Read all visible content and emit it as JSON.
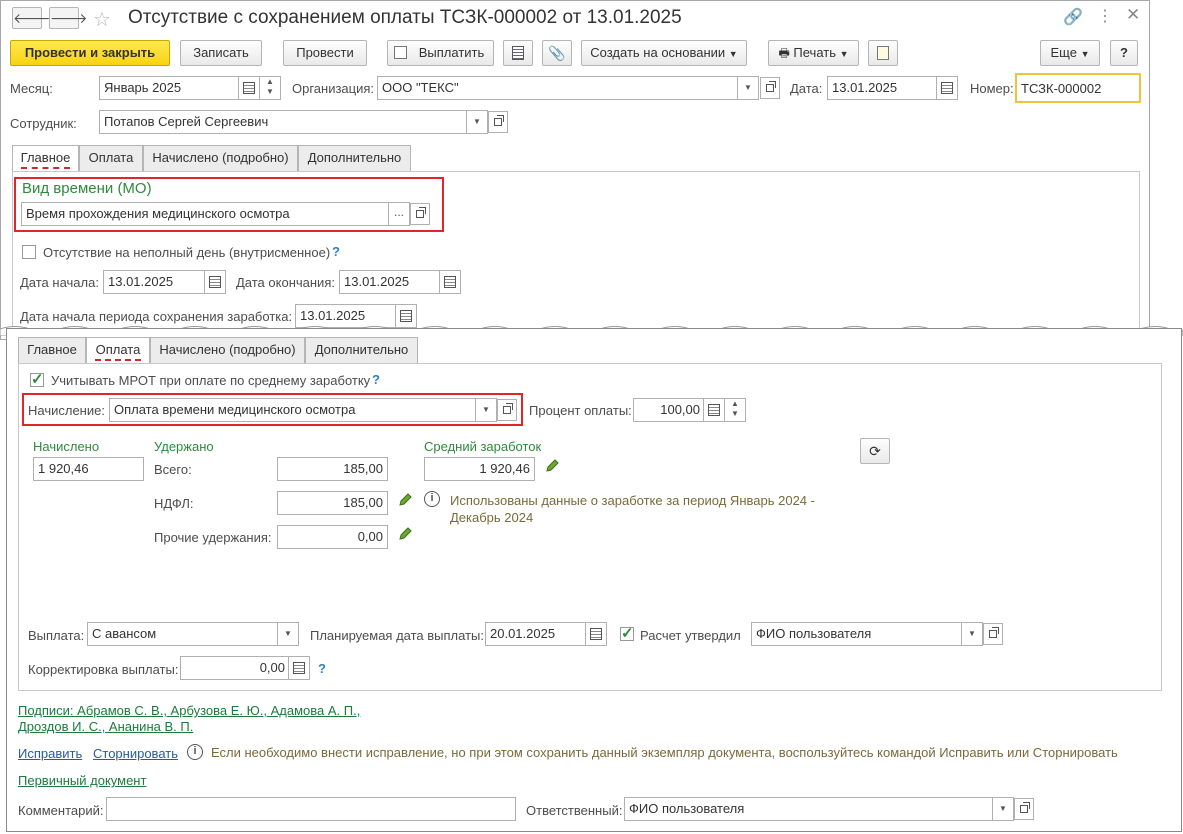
{
  "window": {
    "title": "Отсутствие с сохранением оплаты ТСЗК-000002 от 13.01.2025",
    "nav_back": "🡐",
    "nav_forward": "🡒"
  },
  "toolbar": {
    "post_close": "Провести и закрыть",
    "save": "Записать",
    "post": "Провести",
    "pay": "Выплатить",
    "create_based": "Создать на основании",
    "print": "Печать",
    "more": "Еще",
    "help": "?"
  },
  "header": {
    "month_label": "Месяц:",
    "month_value": "Январь 2025",
    "org_label": "Организация:",
    "org_value": "ООО \"ТЕКС\"",
    "date_label": "Дата:",
    "date_value": "13.01.2025",
    "number_label": "Номер:",
    "number_value": "ТСЗК-000002",
    "employee_label": "Сотрудник:",
    "employee_value": "Потапов Сергей Сергеевич"
  },
  "tabs": [
    "Главное",
    "Оплата",
    "Начислено (подробно)",
    "Дополнительно"
  ],
  "main_tab": {
    "time_type_label": "Вид времени (МО)",
    "time_type_value": "Время прохождения медицинского осмотра",
    "ellipsis": "...",
    "partial_day_label": "Отсутствие на неполный день (внутрисменное)",
    "question": "?",
    "start_label": "Дата начала:",
    "start_value": "13.01.2025",
    "end_label": "Дата окончания:",
    "end_value": "13.01.2025",
    "period_start_label": "Дата начала периода сохранения заработка:",
    "period_start_value": "13.01.2025"
  },
  "pay_tab": {
    "mrot_label": "Учитывать МРОТ при оплате по среднему заработку",
    "accrual_label": "Начисление:",
    "accrual_value": "Оплата времени медицинского осмотра",
    "percent_label": "Процент оплаты:",
    "percent_value": "100,00",
    "accrued_header": "Начислено",
    "accrued_value": "1 920,46",
    "withheld_header": "Удержано",
    "total_label": "Всего:",
    "total_value": "185,00",
    "ndfl_label": "НДФЛ:",
    "ndfl_value": "185,00",
    "other_label": "Прочие удержания:",
    "other_value": "0,00",
    "avg_header": "Средний заработок",
    "avg_value": "1 920,46",
    "info_note": "Использованы данные о заработке за период Январь 2024 - Декабрь 2024",
    "payout_label": "Выплата:",
    "payout_value": "С авансом",
    "planned_date_label": "Планируемая дата выплаты:",
    "planned_date_value": "20.01.2025",
    "approved_label": "Расчет утвердил",
    "approved_value": "ФИО пользователя",
    "correction_label": "Корректировка выплаты:",
    "correction_value": "0,00"
  },
  "footer": {
    "signatures_line1": "Подписи: Абрамов С. В., Арбузова Е. Ю., Адамова А. П.,",
    "signatures_line2": "Дроздов И. С., Ананина В. П.",
    "fix": "Исправить",
    "reverse": "Сторнировать",
    "fix_note": "Если необходимо внести исправление, но при этом сохранить данный экземпляр документа, воспользуйтесь командой Исправить или Сторнировать",
    "primary_doc": "Первичный документ",
    "comment_label": "Комментарий:",
    "comment_value": "",
    "responsible_label": "Ответственный:",
    "responsible_value": "ФИО пользователя"
  }
}
